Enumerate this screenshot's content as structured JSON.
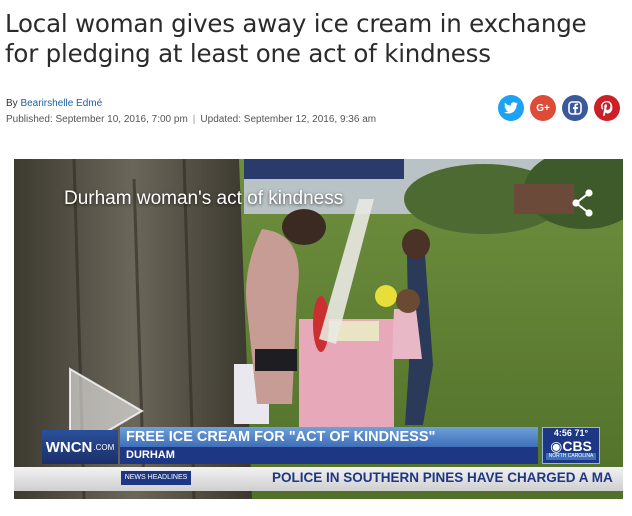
{
  "article": {
    "headline_line1": "Local woman gives away ice cream in exchange",
    "headline_line2": "for pledging at least one act of kindness",
    "byline_prefix": "By",
    "author": "Bearirshelle Edmé",
    "published": "Published: September 10, 2016, 7:00 pm",
    "separator": "|",
    "updated": "Updated: September 12, 2016, 9:36 am"
  },
  "share": {
    "buttons": [
      {
        "name": "twitter",
        "glyph": "🐦",
        "color": "#1da1f2"
      },
      {
        "name": "google-plus",
        "glyph": "G+",
        "color": "#dd4b39"
      },
      {
        "name": "facebook",
        "glyph": "f",
        "color": "#3b5998"
      },
      {
        "name": "pinterest",
        "glyph": "P",
        "color": "#cb2027"
      }
    ]
  },
  "video": {
    "title": "Durham woman's act of kindness",
    "share_icon": "share-icon",
    "play_icon": "play-icon",
    "station_logo": "WNCN",
    "station_logo_suffix": ".COM",
    "lower_third_headline": "FREE ICE CREAM FOR \"ACT OF KINDNESS\"",
    "lower_third_location": "DURHAM",
    "clock": "4:56",
    "temperature": "71°",
    "network_logo": "CBS",
    "network_sub": "NORTH CAROLINA",
    "crawl_label": "NEWS HEADLINES",
    "crawl_text": "POLICE IN SOUTHERN PINES HAVE CHARGED A MA"
  }
}
